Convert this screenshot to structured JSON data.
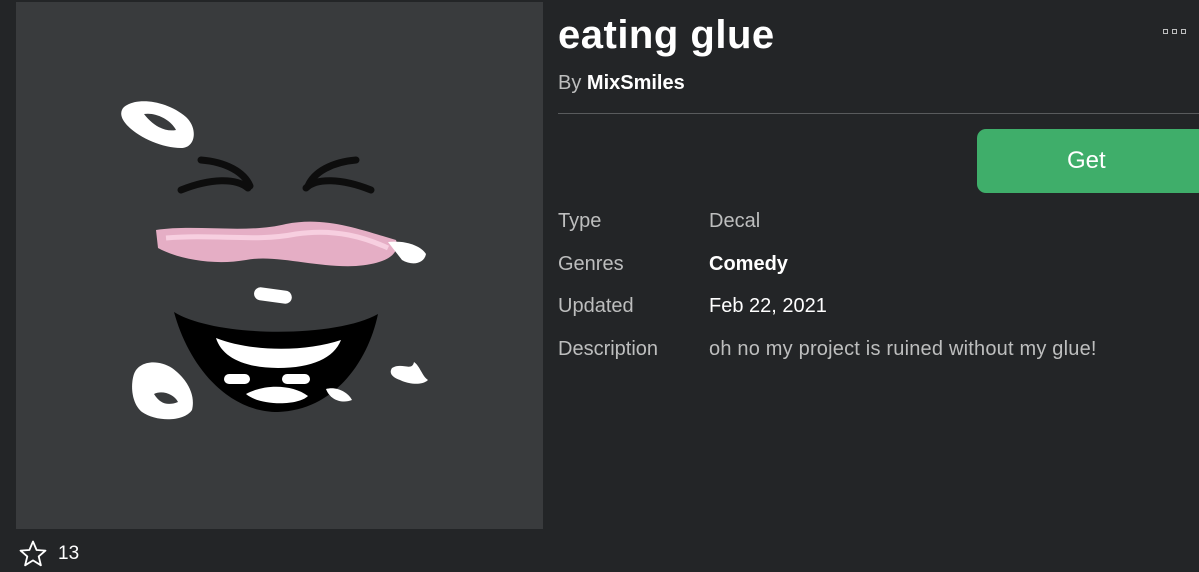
{
  "asset": {
    "title": "eating glue",
    "by_prefix": "By",
    "creator": "MixSmiles",
    "favorites": "13"
  },
  "actions": {
    "get_label": "Get"
  },
  "details": {
    "type_label": "Type",
    "type_value": "Decal",
    "genres_label": "Genres",
    "genres_value": "Comedy",
    "updated_label": "Updated",
    "updated_value": "Feb 22, 2021",
    "description_label": "Description",
    "description_value": "oh no my project is ruined without my glue!"
  },
  "icons": {
    "favorite": "star-outline-icon",
    "more": "more-options-icon"
  },
  "colors": {
    "background": "#232527",
    "thumbnail_bg": "#393b3d",
    "get_button": "#3fae6a",
    "secondary_text": "#bdbebe",
    "blush": "#f4b8d0"
  }
}
